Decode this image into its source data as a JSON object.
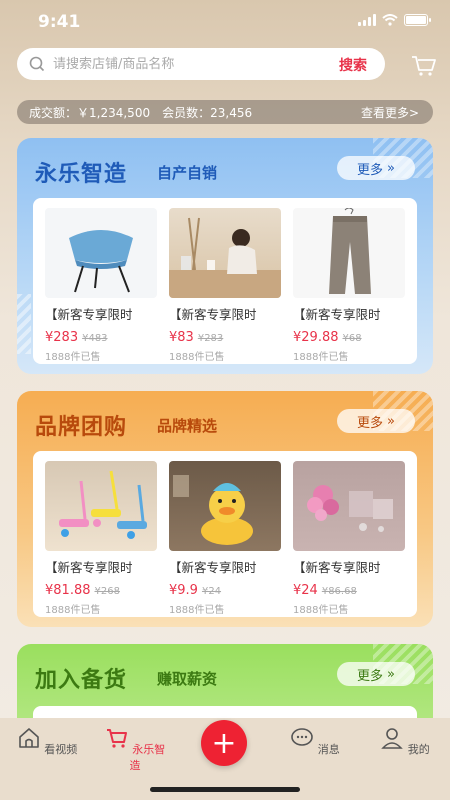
{
  "status": {
    "time": "9:41"
  },
  "search": {
    "placeholder": "请搜索店铺/商品名称",
    "button": "搜索"
  },
  "stats": {
    "turnover_label": "成交额：",
    "turnover_value": "￥1,234,500",
    "members_label": "会员数：",
    "members_value": "23,456",
    "more": "查看更多>"
  },
  "sections": [
    {
      "title": "永乐智造",
      "subtitle": "自产自销",
      "more": "更多",
      "title_color": "#1f5bb8",
      "products": [
        {
          "name": "【新客专享限时",
          "price": "¥283",
          "orig": "¥483",
          "sold": "1888件已售",
          "image": "blue-chair"
        },
        {
          "name": "【新客专享限时",
          "price": "¥83",
          "orig": "¥283",
          "sold": "1888件已售",
          "image": "woman-at-desk"
        },
        {
          "name": "【新客专享限时",
          "price": "¥29.88",
          "orig": "¥68",
          "sold": "1888件已售",
          "image": "grey-trousers"
        }
      ]
    },
    {
      "title": "品牌团购",
      "subtitle": "品牌精选",
      "more": "更多",
      "title_color": "#b84a0c",
      "products": [
        {
          "name": "【新客专享限时",
          "price": "¥81.88",
          "orig": "¥268",
          "sold": "1888件已售",
          "image": "kids-scooters"
        },
        {
          "name": "【新客专享限时",
          "price": "¥9.9",
          "orig": "¥24",
          "sold": "1888件已售",
          "image": "duck-toy"
        },
        {
          "name": "【新客专享限时",
          "price": "¥24",
          "orig": "¥86.68",
          "sold": "1888件已售",
          "image": "pink-flowers"
        }
      ]
    },
    {
      "title": "加入备货",
      "subtitle": "赚取薪资",
      "more": "更多",
      "title_color": "#3c7a12",
      "products": []
    }
  ],
  "tabbar": [
    {
      "label": "看视频",
      "icon": "home-icon"
    },
    {
      "label": "永乐智造",
      "icon": "cart-icon"
    },
    {
      "label": "",
      "icon": "plus-icon"
    },
    {
      "label": "消息",
      "icon": "chat-icon"
    },
    {
      "label": "我的",
      "icon": "user-icon"
    }
  ],
  "colors": {
    "accent": "#e8334a",
    "fab": "#ee2233"
  }
}
